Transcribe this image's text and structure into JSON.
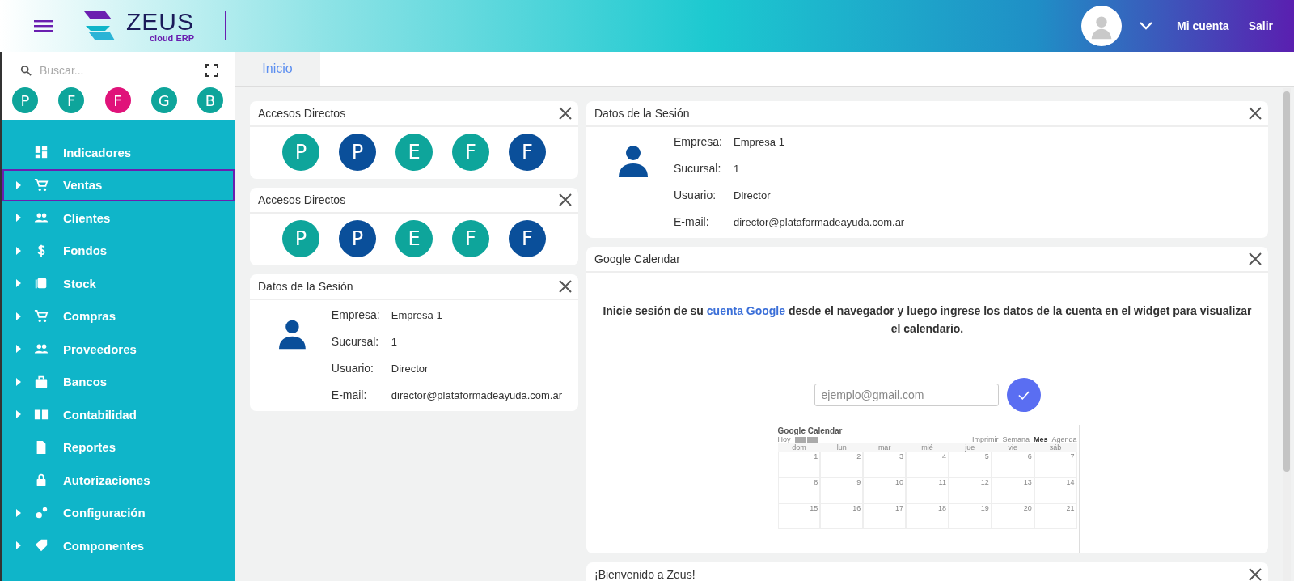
{
  "header": {
    "logo_text": "ZEUS",
    "logo_subtitle": "cloud ERP",
    "account_label": "Mi cuenta",
    "logout_label": "Salir"
  },
  "sidebar": {
    "search": {
      "placeholder": "Buscar..."
    },
    "favorites": [
      {
        "letter": "P",
        "color": "#0ea59b"
      },
      {
        "letter": "F",
        "color": "#0ea59b"
      },
      {
        "letter": "F",
        "color": "#e0137a"
      },
      {
        "letter": "G",
        "color": "#0ea59b"
      },
      {
        "letter": "B",
        "color": "#0ea59b"
      }
    ],
    "items": [
      {
        "label": "Indicadores",
        "expandable": false,
        "selected": false
      },
      {
        "label": "Ventas",
        "expandable": true,
        "selected": true
      },
      {
        "label": "Clientes",
        "expandable": true,
        "selected": false
      },
      {
        "label": "Fondos",
        "expandable": true,
        "selected": false
      },
      {
        "label": "Stock",
        "expandable": true,
        "selected": false
      },
      {
        "label": "Compras",
        "expandable": true,
        "selected": false
      },
      {
        "label": "Proveedores",
        "expandable": true,
        "selected": false
      },
      {
        "label": "Bancos",
        "expandable": true,
        "selected": false
      },
      {
        "label": "Contabilidad",
        "expandable": true,
        "selected": false
      },
      {
        "label": "Reportes",
        "expandable": false,
        "selected": false
      },
      {
        "label": "Autorizaciones",
        "expandable": false,
        "selected": false
      },
      {
        "label": "Configuración",
        "expandable": true,
        "selected": false
      },
      {
        "label": "Componentes",
        "expandable": true,
        "selected": false
      }
    ]
  },
  "tabs": [
    {
      "label": "Inicio",
      "selected": true
    }
  ],
  "left_column": [
    {
      "kind": "shortcuts",
      "title": "Accesos Directos",
      "shortcuts": [
        {
          "letter": "P",
          "color": "#0ea59b"
        },
        {
          "letter": "P",
          "color": "#0a4f9a"
        },
        {
          "letter": "E",
          "color": "#0ea59b"
        },
        {
          "letter": "F",
          "color": "#0ea59b"
        },
        {
          "letter": "F",
          "color": "#0a4f9a"
        }
      ]
    },
    {
      "kind": "shortcuts",
      "title": "Accesos Directos",
      "shortcuts": [
        {
          "letter": "P",
          "color": "#0ea59b"
        },
        {
          "letter": "P",
          "color": "#0a4f9a"
        },
        {
          "letter": "E",
          "color": "#0ea59b"
        },
        {
          "letter": "F",
          "color": "#0ea59b"
        },
        {
          "letter": "F",
          "color": "#0a4f9a"
        }
      ]
    },
    {
      "kind": "session",
      "title": "Datos de la Sesión",
      "fields": [
        {
          "label": "Empresa:",
          "value": "Empresa 1"
        },
        {
          "label": "Sucursal:",
          "value": "1"
        },
        {
          "label": "Usuario:",
          "value": "Director"
        },
        {
          "label": "E-mail:",
          "value": "director@plataformadeayuda.com.ar"
        }
      ]
    }
  ],
  "right_column": [
    {
      "kind": "session",
      "title": "Datos de la Sesión",
      "fields": [
        {
          "label": "Empresa:",
          "value": "Empresa 1"
        },
        {
          "label": "Sucursal:",
          "value": "1"
        },
        {
          "label": "Usuario:",
          "value": "Director"
        },
        {
          "label": "E-mail:",
          "value": "director@plataformadeayuda.com.ar"
        }
      ]
    },
    {
      "kind": "calendar",
      "title": "Google Calendar",
      "message_before": "Inicie sesión de su",
      "link": "cuenta Google",
      "message_after": "desde el navegador y luego ingrese los datos de la cuenta en el widget para visualizar el calendario.",
      "email_field": {
        "placeholder": "ejemplo@gmail.com"
      },
      "preview": {
        "title": "Google Calendar",
        "today": "Hoy",
        "print": "Imprimir",
        "views": [
          {
            "label": "Semana",
            "selected": false
          },
          {
            "label": "Mes",
            "selected": true
          },
          {
            "label": "Agenda",
            "selected": false
          }
        ],
        "weekdays": [
          "dom",
          "lun",
          "mar",
          "mié",
          "jue",
          "vie",
          "sáb"
        ],
        "weeks": [
          [
            "1",
            "2",
            "3",
            "4",
            "5",
            "6",
            "7"
          ],
          [
            "8",
            "9",
            "10",
            "11",
            "12",
            "13",
            "14"
          ],
          [
            "15",
            "16",
            "17",
            "18",
            "19",
            "20",
            "21"
          ]
        ]
      }
    },
    {
      "kind": "welcome",
      "title": "¡Bienvenido a Zeus!"
    }
  ]
}
